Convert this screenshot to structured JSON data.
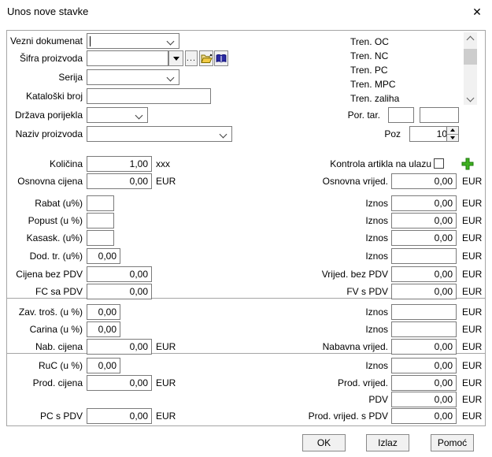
{
  "window": {
    "title": "Unos nove stavke",
    "close_glyph": "✕"
  },
  "top": {
    "vezni": {
      "label": "Vezni dokumenat",
      "value": ""
    },
    "sifra": {
      "label": "Šifra proizvoda",
      "value": "",
      "dots": "..."
    },
    "serija": {
      "label": "Serija",
      "value": ""
    },
    "kataloski": {
      "label": "Kataloški broj",
      "value": ""
    },
    "drzava": {
      "label": "Država porijekla",
      "value": ""
    },
    "naziv": {
      "label": "Naziv proizvoda",
      "value": ""
    },
    "tren_items": [
      "Tren. OC",
      "Tren. NC",
      "Tren. PC",
      "Tren. MPC",
      "Tren. zaliha"
    ],
    "por_tar": {
      "label": "Por. tar.",
      "value1": "",
      "value2": ""
    },
    "poz": {
      "label": "Poz",
      "value": "10"
    }
  },
  "qty": {
    "left": [
      {
        "label": "Količina",
        "value": "1,00",
        "suffix": "xxx"
      },
      {
        "label": "Osnovna cijena",
        "value": "0,00",
        "suffix": "EUR"
      },
      {
        "label": "Rabat (u%)",
        "value": ""
      },
      {
        "label": "Popust (u %)",
        "value": ""
      },
      {
        "label": "Kasask. (u%)",
        "value": ""
      },
      {
        "label": "Dod. tr. (u%)",
        "value": "0,00"
      },
      {
        "label": "Cijena bez PDV",
        "value": "0,00"
      },
      {
        "label": "FC sa PDV",
        "value": "0,00"
      }
    ],
    "control_label": "Kontrola artikla na ulazu",
    "right": [
      {
        "label": "Osnovna vrijed.",
        "value": "0,00",
        "suffix": "EUR"
      },
      {
        "label": "Iznos",
        "value": "0,00",
        "suffix": "EUR"
      },
      {
        "label": "Iznos",
        "value": "0,00",
        "suffix": "EUR"
      },
      {
        "label": "Iznos",
        "value": "0,00",
        "suffix": "EUR"
      },
      {
        "label": "Iznos",
        "value": "",
        "suffix": "EUR"
      },
      {
        "label": "Vrijed. bez PDV",
        "value": "0,00",
        "suffix": "EUR"
      },
      {
        "label": "FV s PDV",
        "value": "0,00",
        "suffix": "EUR"
      }
    ]
  },
  "cost": {
    "left": [
      {
        "label": "Zav. troš. (u %)",
        "value": "0,00"
      },
      {
        "label": "Carina (u %)",
        "value": "0,00"
      },
      {
        "label": "Nab. cijena",
        "value": "0,00",
        "suffix": "EUR"
      }
    ],
    "right": [
      {
        "label": "Iznos",
        "value": "",
        "suffix": "EUR"
      },
      {
        "label": "Iznos",
        "value": "",
        "suffix": "EUR"
      },
      {
        "label": "Nabavna vrijed.",
        "value": "0,00",
        "suffix": "EUR"
      }
    ]
  },
  "sale": {
    "left": [
      {
        "label": "RuC (u %)",
        "value": "0,00"
      },
      {
        "label": "Prod. cijena",
        "value": "0,00",
        "suffix": "EUR"
      },
      {
        "label": "PC s PDV",
        "value": "0,00",
        "suffix": "EUR"
      }
    ],
    "right": [
      {
        "label": "Iznos",
        "value": "0,00",
        "suffix": "EUR"
      },
      {
        "label": "Prod. vrijed.",
        "value": "0,00",
        "suffix": "EUR"
      },
      {
        "label": "PDV",
        "value": "0,00",
        "suffix": "EUR"
      },
      {
        "label": "Prod. vrijed. s PDV",
        "value": "0,00",
        "suffix": "EUR"
      }
    ]
  },
  "buttons": {
    "ok": "OK",
    "izlaz": "Izlaz",
    "pomoc": "Pomoć"
  },
  "colors": {
    "plus_green": "#3fb020",
    "plus_green_dark": "#1e7a0e",
    "input_border": "#7b7b7b",
    "panel_border": "#a5a5a5",
    "button_face": "#f1f1f1",
    "scroll_thumb": "#cdcdcd"
  }
}
